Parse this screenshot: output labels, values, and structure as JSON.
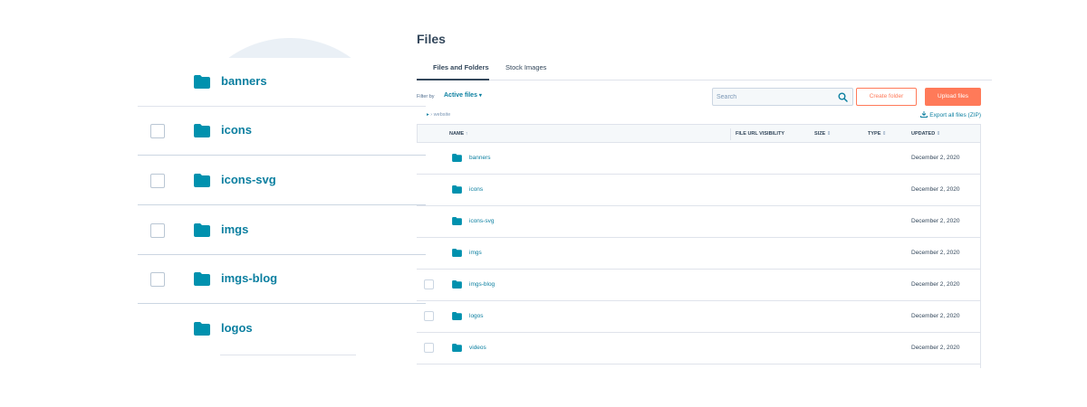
{
  "zoom": {
    "rows": [
      {
        "name": "banners",
        "checkbox": false
      },
      {
        "name": "icons",
        "checkbox": true
      },
      {
        "name": "icons-svg",
        "checkbox": true
      },
      {
        "name": "imgs",
        "checkbox": true
      },
      {
        "name": "imgs-blog",
        "checkbox": true
      },
      {
        "name": "logos",
        "checkbox": false
      }
    ]
  },
  "page": {
    "title": "Files"
  },
  "tabs": [
    {
      "label": "Files and Folders",
      "active": true
    },
    {
      "label": "Stock Images",
      "active": false
    }
  ],
  "filter": {
    "label": "Filter by",
    "value": "Active files",
    "caret": "▾"
  },
  "search": {
    "placeholder": "Search"
  },
  "buttons": {
    "create_folder": "Create folder",
    "upload_files": "Upload files"
  },
  "breadcrumb": {
    "home": "▸",
    "separator": "›",
    "current": "website"
  },
  "export": {
    "label": "Export all files (ZIP)"
  },
  "table": {
    "headers": {
      "name": "NAME",
      "name_sort": "↑",
      "visibility": "FILE URL VISIBILITY",
      "size": "SIZE",
      "type": "TYPE",
      "updated": "UPDATED",
      "sort_icon": "⇕"
    },
    "rows": [
      {
        "name": "banners",
        "updated": "December 2, 2020",
        "checkbox": false
      },
      {
        "name": "icons",
        "updated": "December 2, 2020",
        "checkbox": false
      },
      {
        "name": "icons-svg",
        "updated": "December 2, 2020",
        "checkbox": false
      },
      {
        "name": "imgs",
        "updated": "December 2, 2020",
        "checkbox": false
      },
      {
        "name": "imgs-blog",
        "updated": "December 2, 2020",
        "checkbox": true
      },
      {
        "name": "logos",
        "updated": "December 2, 2020",
        "checkbox": true
      },
      {
        "name": "videos",
        "updated": "December 2, 2020",
        "checkbox": true
      }
    ]
  },
  "colors": {
    "accent": "#ff7a59",
    "link": "#0b7fa0",
    "folder": "#0091ae",
    "text": "#33475b",
    "border": "#dfe3eb",
    "header_bg": "#f5f8fa"
  },
  "icons": {
    "folder": "folder-icon",
    "search": "search-icon",
    "export": "download-icon",
    "checkbox": "checkbox"
  }
}
